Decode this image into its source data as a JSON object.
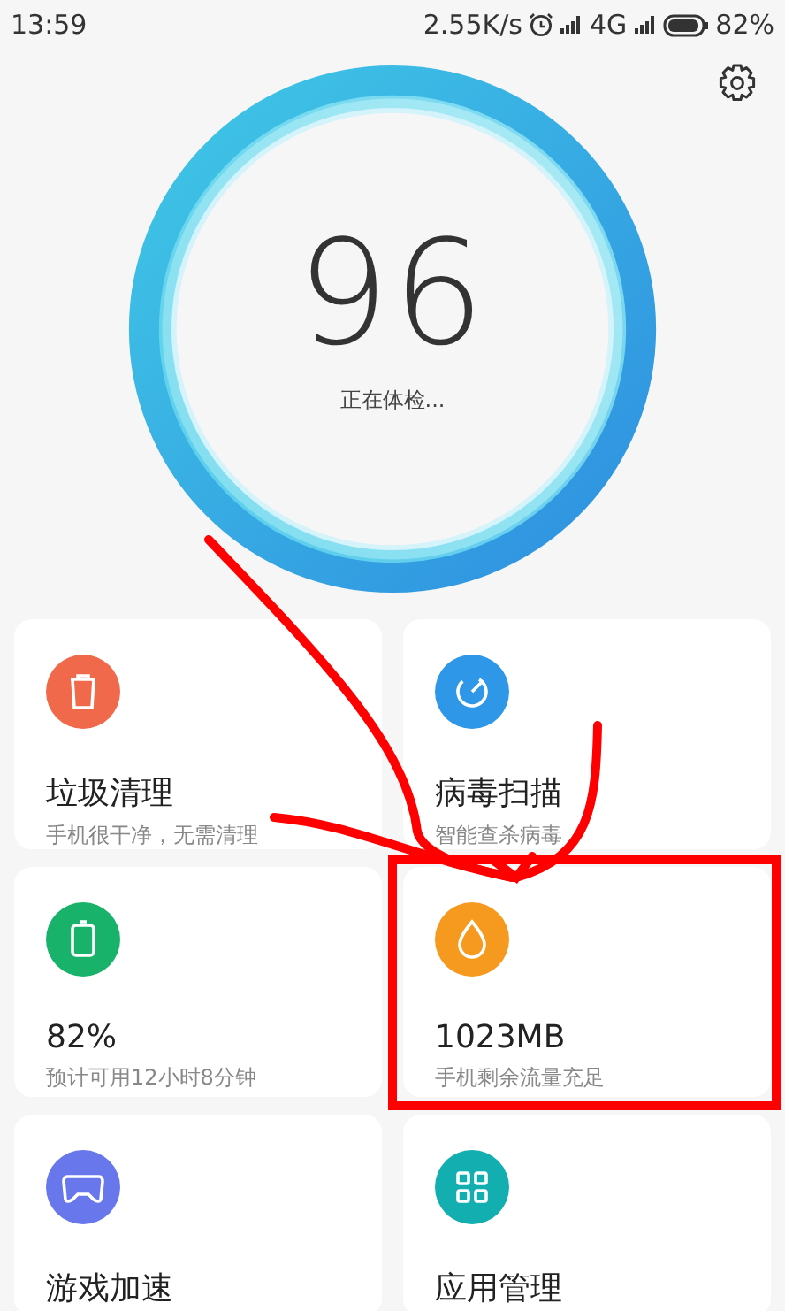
{
  "status_bar": {
    "time": "13:59",
    "speed": "2.55K/s",
    "network": "4G",
    "battery": "82%"
  },
  "score": {
    "value": "96",
    "caption": "正在体检..."
  },
  "cards": [
    {
      "kind": "trash",
      "color": "#f0694a",
      "title": "垃圾清理",
      "subtitle": "手机很干净，无需清理"
    },
    {
      "kind": "gauge",
      "color": "#2f97e8",
      "title": "病毒扫描",
      "subtitle": "智能查杀病毒"
    },
    {
      "kind": "battery",
      "color": "#18b26b",
      "title": "82%",
      "subtitle": "预计可用12小时8分钟"
    },
    {
      "kind": "drop",
      "color": "#f59a1f",
      "title": "1023MB",
      "subtitle": "手机剩余流量充足"
    },
    {
      "kind": "gamepad",
      "color": "#6878ec",
      "title": "游戏加速"
    },
    {
      "kind": "grid",
      "color": "#13aeb0",
      "title": "应用管理"
    }
  ]
}
